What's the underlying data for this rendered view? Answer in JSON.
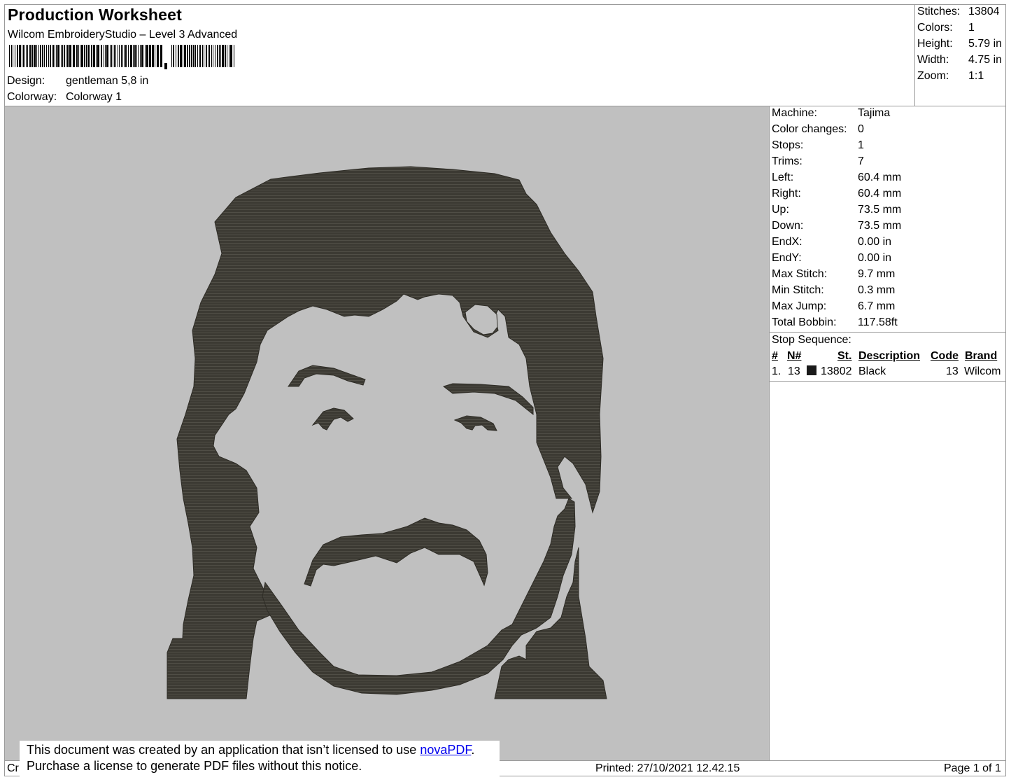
{
  "header": {
    "title": "Production Worksheet",
    "software": "Wilcom EmbroideryStudio – Level 3 Advanced",
    "design_label": "Design:",
    "design_value": "gentleman 5,8 in",
    "colorway_label": "Colorway:",
    "colorway_value": "Colorway 1"
  },
  "summary": {
    "stitches_label": "Stitches:",
    "stitches_value": "13804",
    "colors_label": "Colors:",
    "colors_value": "1",
    "height_label": "Height:",
    "height_value": "5.79 in",
    "width_label": "Width:",
    "width_value": "4.75 in",
    "zoom_label": "Zoom:",
    "zoom_value": "1:1"
  },
  "machine": [
    {
      "label": "Machine:",
      "value": "Tajima"
    },
    {
      "label": "Color changes:",
      "value": "0"
    },
    {
      "label": "Stops:",
      "value": "1"
    },
    {
      "label": "Trims:",
      "value": "7"
    },
    {
      "label": "Left:",
      "value": "60.4 mm"
    },
    {
      "label": "Right:",
      "value": "60.4 mm"
    },
    {
      "label": "Up:",
      "value": "73.5 mm"
    },
    {
      "label": "Down:",
      "value": "73.5 mm"
    },
    {
      "label": "EndX:",
      "value": "0.00 in"
    },
    {
      "label": "EndY:",
      "value": "0.00 in"
    },
    {
      "label": "Max Stitch:",
      "value": "9.7 mm"
    },
    {
      "label": "Min Stitch:",
      "value": "0.3 mm"
    },
    {
      "label": "Max Jump:",
      "value": "6.7 mm"
    },
    {
      "label": "Total Bobbin:",
      "value": "117.58ft"
    }
  ],
  "stop_sequence": {
    "title": "Stop Sequence:",
    "headers": {
      "num": "#",
      "needle": "N#",
      "stitches": "St.",
      "description": "Description",
      "code": "Code",
      "brand": "Brand"
    },
    "rows": [
      {
        "num": "1.",
        "needle": "13",
        "swatch_color": "#1a1a1a",
        "stitches": "13802",
        "description": "Black",
        "code": "13",
        "brand": "Wilcom"
      }
    ]
  },
  "design_preview": {
    "background_color": "#c0c0c0",
    "thread_color": "#3c3a33"
  },
  "notice": {
    "line1_prefix": "This document was created by an application that isn’t licensed to use ",
    "line1_link": "novaPDF",
    "line1_suffix": ".",
    "line2": "Purchase a license to generate PDF files without this notice."
  },
  "footer": {
    "left_fragment": "Cr",
    "printed": "Printed: 27/10/2021 12.42.15",
    "page": "Page 1 of 1"
  }
}
